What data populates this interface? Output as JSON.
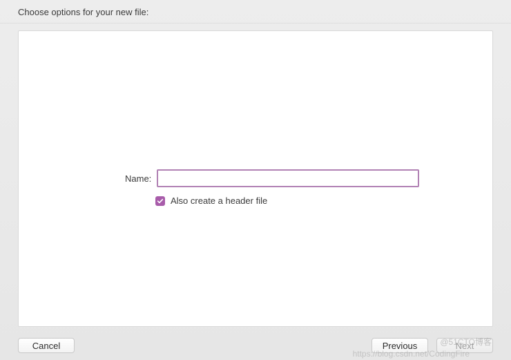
{
  "header": {
    "title": "Choose options for your new file:"
  },
  "form": {
    "name_label": "Name:",
    "name_value": "",
    "name_placeholder": "",
    "header_checkbox": {
      "checked": true,
      "label": "Also create a header file"
    }
  },
  "footer": {
    "cancel_label": "Cancel",
    "previous_label": "Previous",
    "next_label": "Next"
  },
  "watermarks": {
    "w1": "@51CTO博客",
    "w2": "https://blog.csdn.net/CodingFire"
  }
}
